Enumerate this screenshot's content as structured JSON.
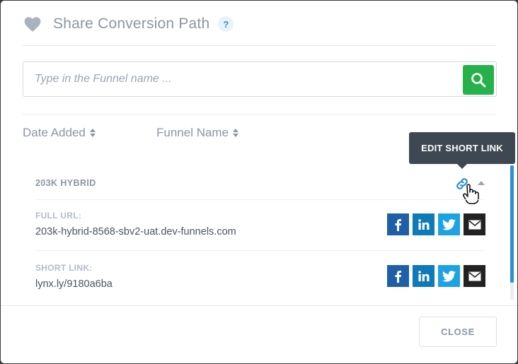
{
  "header": {
    "title": "Share Conversion Path",
    "help_label": "?"
  },
  "search": {
    "placeholder": "Type in the Funnel name ..."
  },
  "sort": {
    "date_added": "Date Added",
    "funnel_name": "Funnel Name"
  },
  "tooltip": {
    "text": "EDIT SHORT LINK"
  },
  "funnel": {
    "name": "203K HYBRID",
    "full_url_label": "FULL URL:",
    "full_url": "203k-hybrid-8568-sbv2-uat.dev-funnels.com",
    "short_link_label": "SHORT LINK:",
    "short_link": "lynx.ly/9180a6ba"
  },
  "footer": {
    "close_label": "CLOSE"
  },
  "colors": {
    "accent": "#2b8fd6",
    "search_button": "#27b14b",
    "facebook": "#1e5fa8",
    "linkedin": "#0f7ab7",
    "twitter": "#1da3e5",
    "email": "#222222"
  }
}
